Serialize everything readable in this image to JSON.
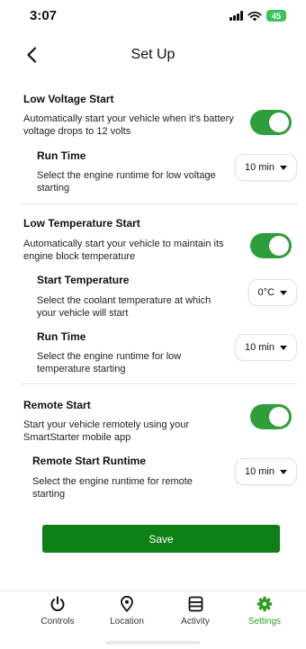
{
  "status": {
    "time": "3:07",
    "battery": "45"
  },
  "header": {
    "title": "Set Up"
  },
  "low_voltage": {
    "title": "Low Voltage Start",
    "description": "Automatically start your vehicle when it's battery voltage drops to 12 volts",
    "enabled": true,
    "run_time": {
      "title": "Run Time",
      "description": "Select the engine runtime for low voltage starting",
      "value": "10 min"
    }
  },
  "low_temperature": {
    "title": "Low Temperature Start",
    "description": "Automatically start your vehicle to maintain its engine block temperature",
    "enabled": true,
    "start_temperature": {
      "title": "Start Temperature",
      "description": "Select the coolant temperature at which your vehicle will start",
      "value": "0°C"
    },
    "run_time": {
      "title": "Run Time",
      "description": "Select the engine runtime for low temperature starting",
      "value": "10 min"
    }
  },
  "remote_start": {
    "title": "Remote Start",
    "description": "Start your vehicle remotely using your SmartStarter mobile app",
    "enabled": true,
    "runtime": {
      "title": "Remote Start Runtime",
      "description": "Select the engine runtime for remote starting",
      "value": "10 min"
    }
  },
  "actions": {
    "save_label": "Save"
  },
  "tabs": [
    {
      "label": "Controls",
      "icon": "power-icon",
      "active": false
    },
    {
      "label": "Location",
      "icon": "location-pin-icon",
      "active": false
    },
    {
      "label": "Activity",
      "icon": "activity-list-icon",
      "active": false
    },
    {
      "label": "Settings",
      "icon": "gear-icon",
      "active": true
    }
  ],
  "colors": {
    "accent_green": "#2e9e3b",
    "save_button": "#0e7f14",
    "active_tab": "#2f9a22",
    "battery": "#3cc55a"
  }
}
